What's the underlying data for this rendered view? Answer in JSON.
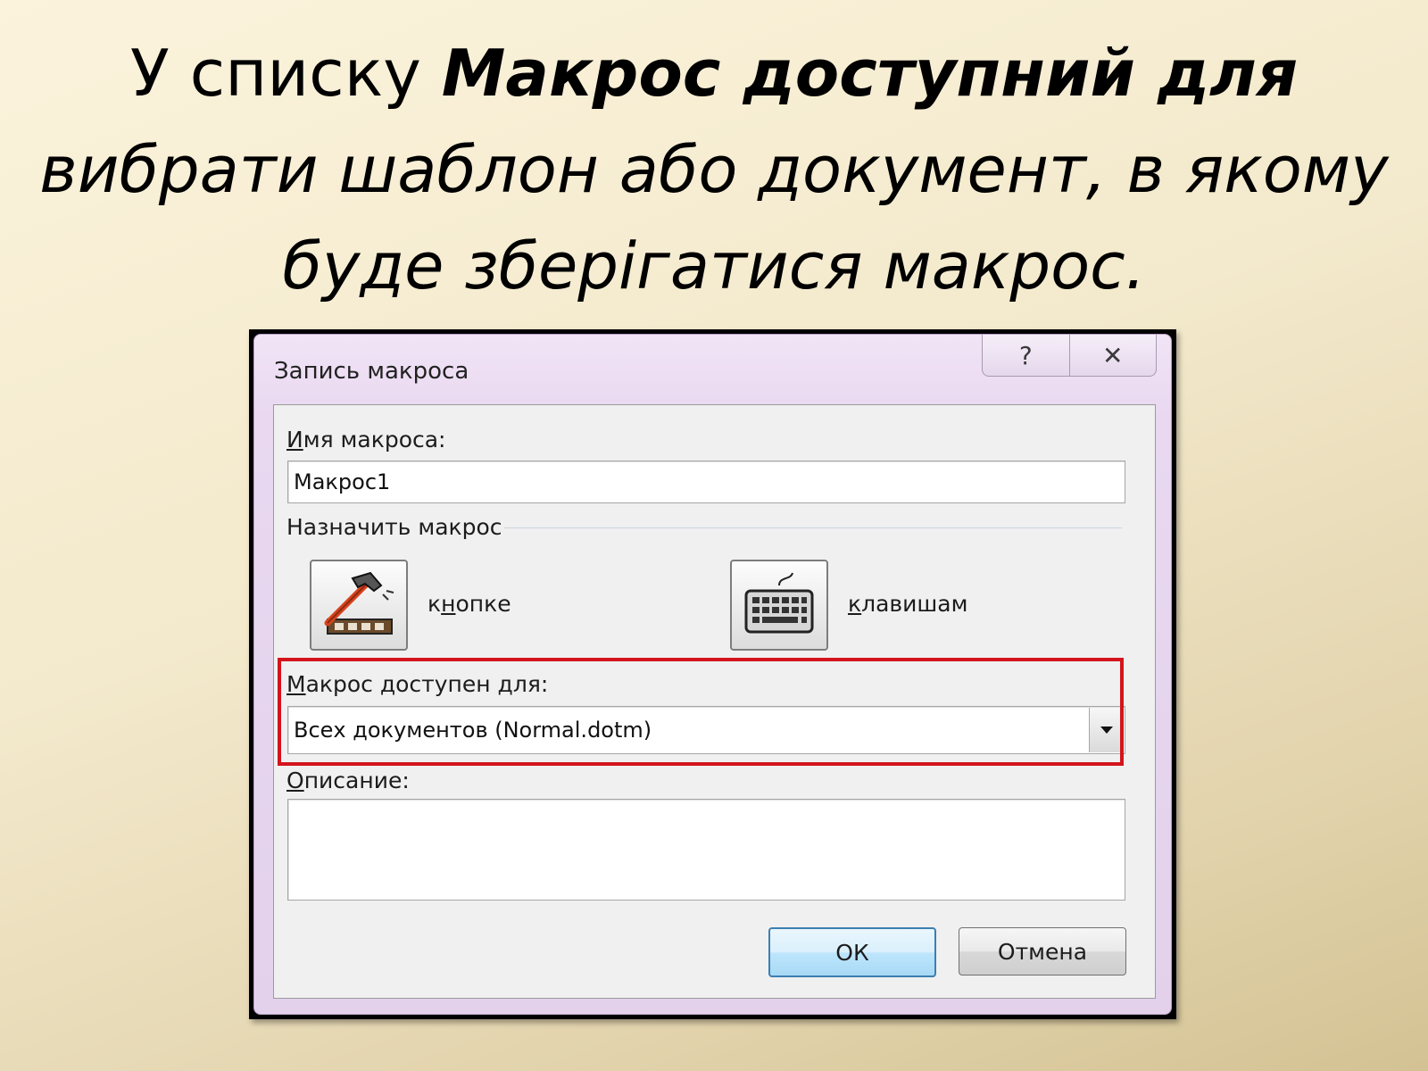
{
  "caption": {
    "line1_plain": "У списку ",
    "line1_bold": "Макрос доступний для",
    "line2": "вибрати шаблон або документ, в якому",
    "line3": "буде зберігатися макрос."
  },
  "dialog": {
    "title": "Запись макроса",
    "help_glyph": "?",
    "close_glyph": "✕",
    "macro_name": {
      "label_ul": "И",
      "label_rest": "мя макроса:",
      "value": "Макрос1"
    },
    "assign": {
      "heading": "Назначить макрос",
      "button_option": {
        "pre": "к",
        "ul": "н",
        "post": "опке"
      },
      "keyboard_option": {
        "pre": "",
        "ul": "к",
        "post": "лавишам"
      }
    },
    "available_for": {
      "label_ul": "М",
      "label_rest": "акрос доступен для:",
      "value": "Всех документов (Normal.dotm)"
    },
    "description": {
      "label_ul": "О",
      "label_rest": "писание:",
      "value": ""
    },
    "ok_label": "ОК",
    "cancel_label": "Отмена"
  },
  "colors": {
    "highlight": "#d4141c",
    "dialog_chrome": "#e9d8f0",
    "default_button": "#3c7fb1"
  },
  "icons": [
    "help-icon",
    "close-icon",
    "hammer-icon",
    "keyboard-icon",
    "dropdown-arrow-icon"
  ]
}
